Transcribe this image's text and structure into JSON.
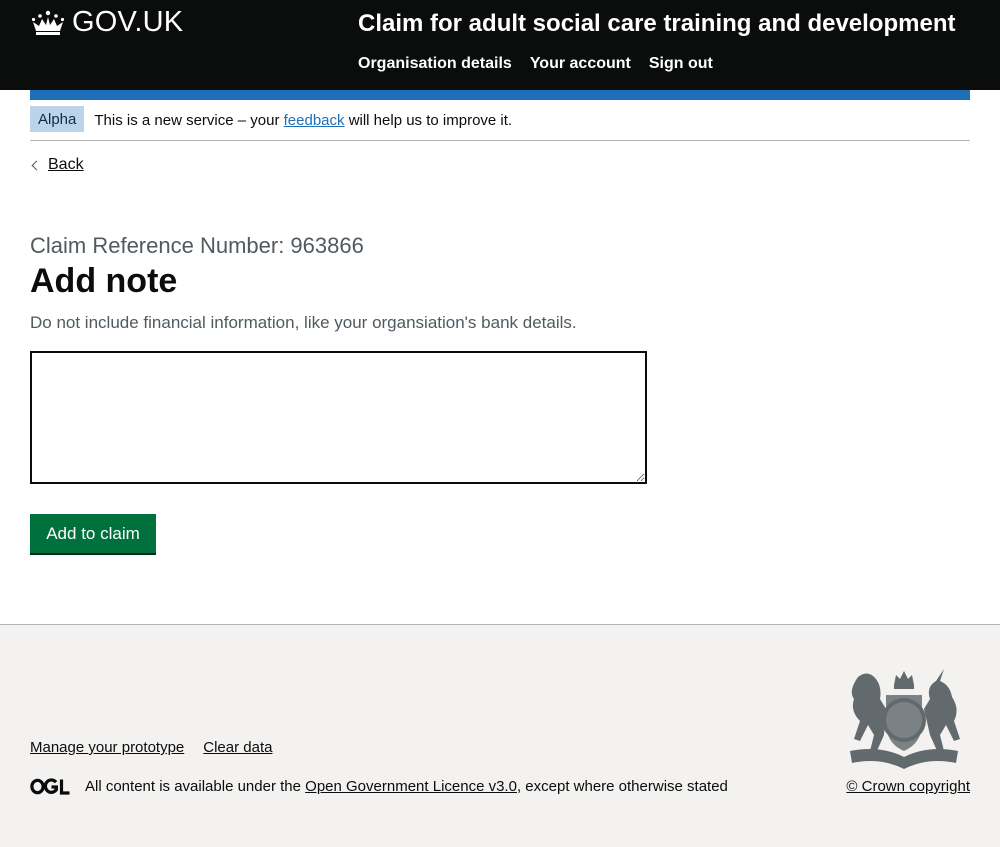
{
  "header": {
    "logo_text": "GOV.UK",
    "service_name": "Claim for adult social care training and development",
    "nav": [
      {
        "label": "Organisation details"
      },
      {
        "label": "Your account"
      },
      {
        "label": "Sign out"
      }
    ]
  },
  "phase_banner": {
    "tag": "Alpha",
    "text_before": "This is a new service – your",
    "link": "feedback",
    "text_after": "will help us to improve it."
  },
  "back_link": "Back",
  "main": {
    "caption": "Claim Reference Number: 963866",
    "heading": "Add note",
    "hint": "Do not include financial information, like your organsiation's bank details.",
    "textarea_value": "",
    "button_label": "Add to claim"
  },
  "footer": {
    "links": [
      {
        "label": "Manage your prototype"
      },
      {
        "label": "Clear data"
      }
    ],
    "licence_before": "All content is available under the",
    "licence_link": "Open Government Licence v3.0",
    "licence_after": ", except where otherwise stated",
    "copyright": "© Crown copyright"
  },
  "colors": {
    "header_bg": "#0b0c0c",
    "brand_blue": "#1d70b8",
    "button_green": "#00703c",
    "tag_bg": "#bbd4ea",
    "footer_bg": "#f3f2f1"
  },
  "icons": [
    "crown-icon",
    "chevron-left-icon",
    "ogl-logo",
    "royal-coat-of-arms"
  ]
}
